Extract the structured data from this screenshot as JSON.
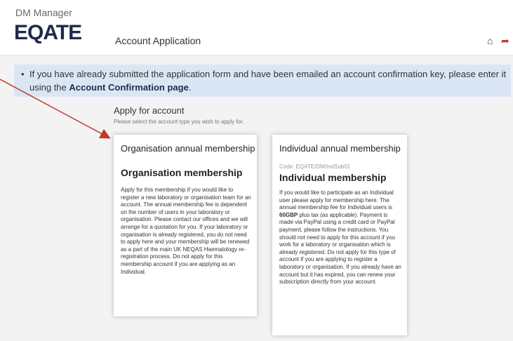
{
  "header": {
    "app_name": "DM Manager",
    "logo_text": "EQATE",
    "page_title": "Account Application",
    "icons": [
      "home-icon",
      "logout-icon"
    ]
  },
  "banner": {
    "line1": "If you have already submitted the application form and have been emailed an account confirmation key, please enter it",
    "line2_prefix": "using the ",
    "link_label": "Account Confirmation page",
    "line2_suffix": "."
  },
  "apply": {
    "title": "Apply for account",
    "subtitle": "Please select the account type you wish to apply for."
  },
  "cards": {
    "org": {
      "heading": "Organisation annual membership",
      "name": "Organisation membership",
      "body": "Apply for this membership if you would like to register a new laboratory or organisation team for an account. The annual membership fee is dependent on the number of users in your laboratory or organisation. Please contact our offices and we will arrange for a quotation for you. If your laboratory or organisation is already registered, you do not need to apply here and your membership will be renewed as a part of the main UK NEQAS Haematology re-registration process. Do not apply for this membership account if you are applying as an Individual."
    },
    "ind": {
      "heading": "Individual annual membership",
      "code": "Code: EQATE/DM/IndSub01",
      "name": "Individual membership",
      "body_pre": "If you would like to participate as an Individual user please apply for membership here. The annual membership fee for Individual users is ",
      "fee": "60GBP",
      "body_post": " plus tax (as applicable). Payment is made via PayPal using a credit card or PayPal payment, please follow the instructions. You should not need to apply for this account if you work for a laboratory or organisation which is already registered. Do not apply for this type of account if you are applying to register a laboratory or organisation. If you already have an account but it has expired, you can renew your subscription directly from your account."
    }
  },
  "colors": {
    "banner_bg": "#dbe6f5",
    "logo": "#1d2b4a",
    "annotation_arrow": "#c0392b"
  }
}
